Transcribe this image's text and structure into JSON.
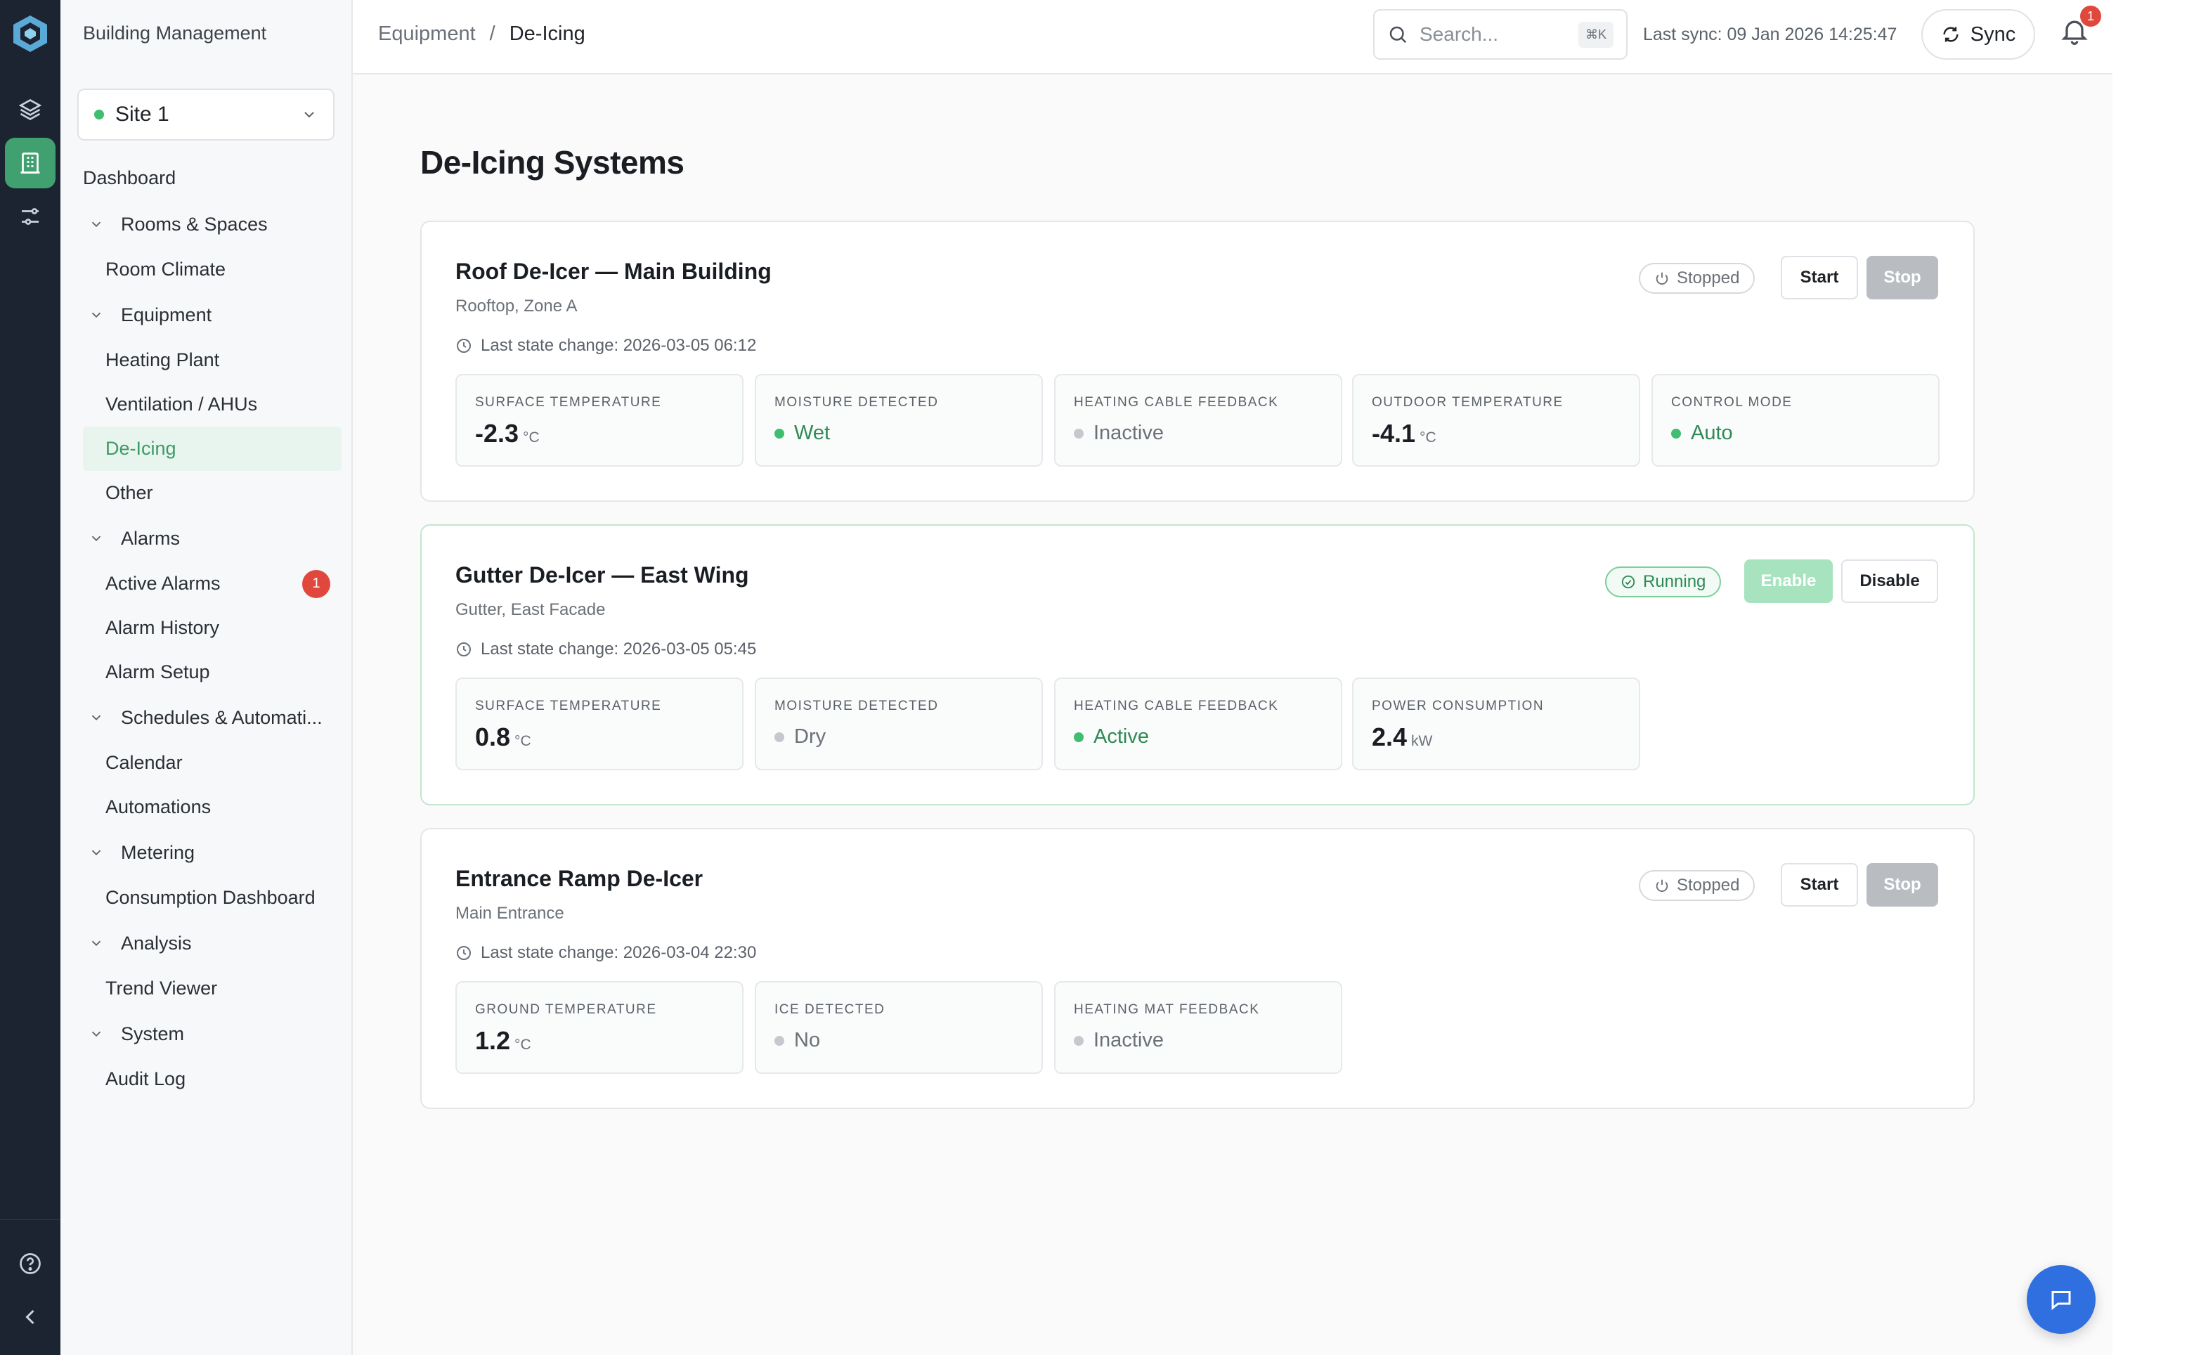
{
  "app": {
    "title": "Building Management"
  },
  "rail": {
    "icons": [
      "logo-icon",
      "layers-icon",
      "building-icon",
      "sliders-icon",
      "help-icon",
      "collapse-icon"
    ]
  },
  "sidebar": {
    "site": {
      "label": "Site 1",
      "status_color": "#3fbe6f"
    },
    "nav": {
      "dashboard": "Dashboard",
      "rooms": {
        "label": "Rooms & Spaces",
        "items": [
          "Room Climate"
        ]
      },
      "equipment": {
        "label": "Equipment",
        "items": [
          "Heating Plant",
          "Ventilation / AHUs",
          "De-Icing",
          "Other"
        ]
      },
      "alarms": {
        "label": "Alarms",
        "items": [
          "Active Alarms",
          "Alarm History",
          "Alarm Setup"
        ],
        "active_count": "1"
      },
      "schedules": {
        "label": "Schedules & Automati...",
        "items": [
          "Calendar",
          "Automations"
        ]
      },
      "metering": {
        "label": "Metering",
        "items": [
          "Consumption Dashboard"
        ]
      },
      "analysis": {
        "label": "Analysis",
        "items": [
          "Trend Viewer"
        ]
      },
      "system": {
        "label": "System",
        "items": [
          "Audit Log"
        ]
      }
    }
  },
  "header": {
    "breadcrumb": [
      "Equipment",
      "/",
      "De-Icing"
    ],
    "search": {
      "placeholder": "Search...",
      "shortcut": "⌘K"
    },
    "last_sync": "Last sync: 09 Jan 2026 14:25:47",
    "sync_label": "Sync",
    "notifications": "1"
  },
  "page": {
    "title": "De-Icing Systems",
    "systems": [
      {
        "name": "Roof De-Icer — Main Building",
        "location": "Rooftop, Zone A",
        "last_change": "Last state change: 2026-03-05 06:12",
        "status": "Stopped",
        "buttons": [
          "Start",
          "Stop"
        ],
        "metrics": [
          {
            "label": "SURFACE TEMPERATURE",
            "value": "-2.3",
            "unit": "°C"
          },
          {
            "label": "MOISTURE DETECTED",
            "status": "Wet",
            "on": true
          },
          {
            "label": "HEATING CABLE FEEDBACK",
            "status": "Inactive",
            "on": false
          },
          {
            "label": "OUTDOOR TEMPERATURE",
            "value": "-4.1",
            "unit": "°C"
          },
          {
            "label": "CONTROL MODE",
            "status": "Auto",
            "on": true
          }
        ]
      },
      {
        "name": "Gutter De-Icer — East Wing",
        "location": "Gutter, East Facade",
        "last_change": "Last state change: 2026-03-05 05:45",
        "status": "Running",
        "buttons": [
          "Enable",
          "Disable"
        ],
        "metrics": [
          {
            "label": "SURFACE TEMPERATURE",
            "value": "0.8",
            "unit": "°C"
          },
          {
            "label": "MOISTURE DETECTED",
            "status": "Dry",
            "on": false
          },
          {
            "label": "HEATING CABLE FEEDBACK",
            "status": "Active",
            "on": true
          },
          {
            "label": "POWER CONSUMPTION",
            "value": "2.4",
            "unit": "kW"
          }
        ]
      },
      {
        "name": "Entrance Ramp De-Icer",
        "location": "Main Entrance",
        "last_change": "Last state change: 2026-03-04 22:30",
        "status": "Stopped",
        "buttons": [
          "Start",
          "Stop"
        ],
        "metrics": [
          {
            "label": "GROUND TEMPERATURE",
            "value": "1.2",
            "unit": "°C"
          },
          {
            "label": "ICE DETECTED",
            "status": "No",
            "on": false
          },
          {
            "label": "HEATING MAT FEEDBACK",
            "status": "Inactive",
            "on": false
          }
        ]
      }
    ]
  },
  "colors": {
    "accent": "#41a06f",
    "rail_bg": "#1b2430",
    "alarm": "#e0483e",
    "chat": "#2f6fe0"
  }
}
